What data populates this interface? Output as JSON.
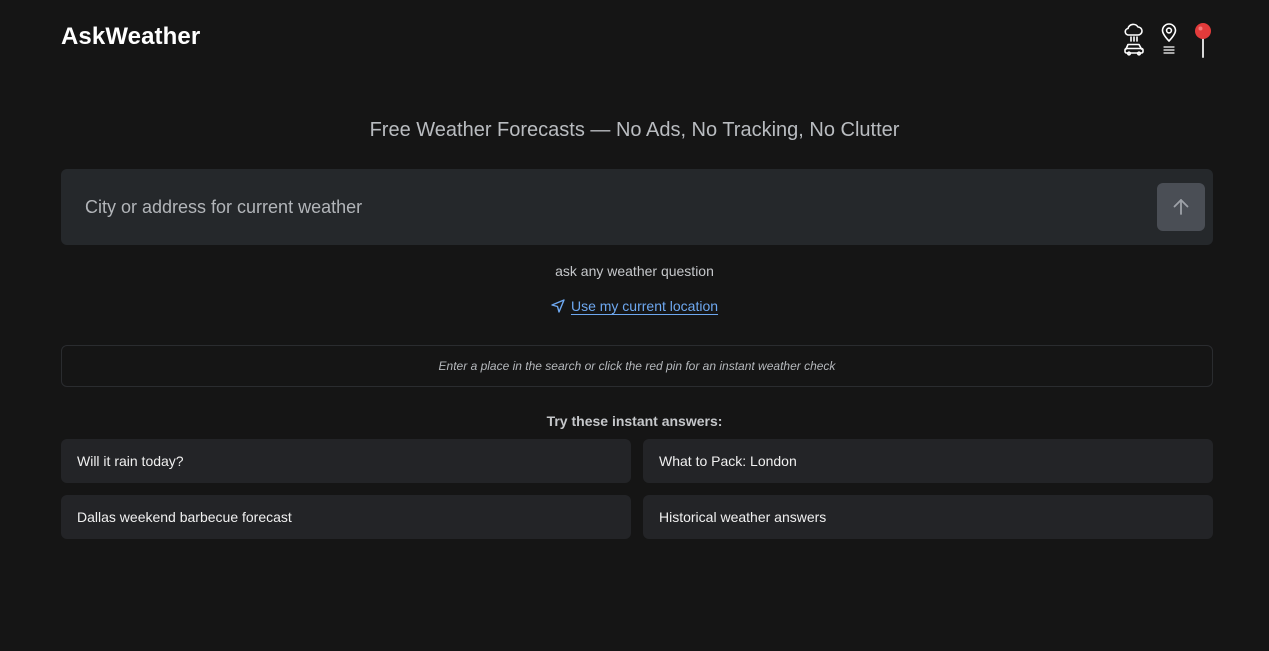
{
  "header": {
    "brand": "AskWeather",
    "icons": [
      "rain-car-icon",
      "map-pin-list-icon",
      "red-pin-icon"
    ]
  },
  "hero": {
    "tagline": "Free Weather Forecasts — No Ads, No Tracking, No Clutter"
  },
  "search": {
    "placeholder": "City or address for current weather",
    "value": "",
    "submit_icon": "arrow-up-icon"
  },
  "hint": "ask any weather question",
  "location": {
    "icon": "navigation-arrow-icon",
    "label": "Use my current location"
  },
  "info": "Enter a place in the search or click the red pin for an instant weather check",
  "suggestions": {
    "title": "Try these instant answers:",
    "items": [
      {
        "label": "Will it rain today?"
      },
      {
        "label": "What to Pack: London"
      },
      {
        "label": "Dallas weekend barbecue forecast"
      },
      {
        "label": "Historical weather answers"
      }
    ]
  },
  "colors": {
    "background": "#151515",
    "surface": "#25282b",
    "button": "#4a4e55",
    "link": "#6ea8f0",
    "pin": "#e23b3b"
  }
}
